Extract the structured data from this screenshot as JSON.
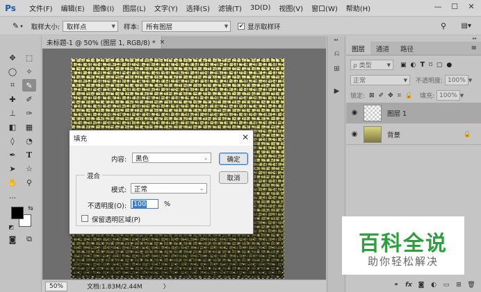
{
  "app": {
    "logo": "Ps"
  },
  "menubar": {
    "items": [
      "文件(F)",
      "编辑(E)",
      "图像(I)",
      "图层(L)",
      "文字(Y)",
      "选择(S)",
      "滤镜(T)",
      "3D(D)",
      "视图(V)",
      "窗口(W)",
      "帮助(H)"
    ],
    "minimize": "—",
    "maximize": "☐",
    "close": "✕"
  },
  "options": {
    "sample_size_label": "取样大小:",
    "sample_size_value": "取样点",
    "sample_label": "样本:",
    "sample_value": "所有图层",
    "show_ring_label": "显示取样环",
    "show_ring_checked": "✔"
  },
  "document": {
    "tab_title": "未标题-1 @ 50% (图层 1, RGB/8) *",
    "tab_close": "×"
  },
  "status": {
    "zoom": "50%",
    "doc_info": "文档:1.83M/2.44M",
    "arrow": "〉"
  },
  "fill_dialog": {
    "title": "填充",
    "close": "✕",
    "content_label": "内容:",
    "content_value": "黑色",
    "blend_legend": "混合",
    "mode_label": "模式:",
    "mode_value": "正常",
    "opacity_label": "不透明度(O):",
    "opacity_value": "100",
    "opacity_unit": "%",
    "preserve_label": "保留透明区域(P)",
    "ok_label": "确定",
    "cancel_label": "取消"
  },
  "layers_panel": {
    "tabs": [
      "图层",
      "通道",
      "路径"
    ],
    "active_tab": 0,
    "kind_placeholder": "ρ 类型",
    "blend_mode": "正常",
    "opacity_label": "不透明度:",
    "opacity_value": "100%",
    "lock_label": "锁定:",
    "fill_label": "填充:",
    "fill_value": "100%",
    "layers": [
      {
        "name": "图层 1",
        "selected": true
      },
      {
        "name": "背景",
        "selected": false,
        "locked": true
      }
    ]
  },
  "watermark": {
    "title": "百科全说",
    "subtitle": "助你轻松解决"
  },
  "colors": {
    "accent": "#3a7bd5",
    "watermark_green": "#2e9f3e"
  }
}
